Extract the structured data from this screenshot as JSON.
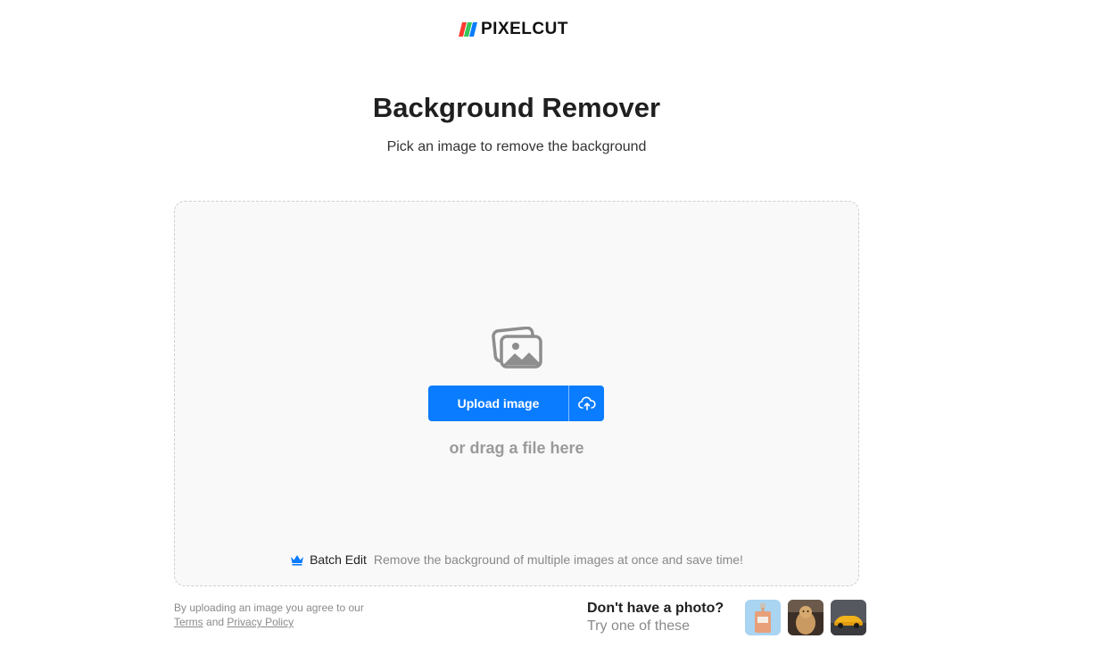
{
  "brand": {
    "name": "PIXELCUT",
    "stripe_colors": [
      "#ff3b30",
      "#34c759",
      "#0a7cff"
    ]
  },
  "header": {
    "title": "Background Remover",
    "subtitle": "Pick an image to remove the background"
  },
  "dropzone": {
    "icon": "photos-icon",
    "upload_label": "Upload image",
    "upload_menu_icon": "cloud-upload-icon",
    "drag_text": "or drag a file here",
    "batch": {
      "icon": "crown-icon",
      "label": "Batch Edit",
      "description": "Remove the background of multiple images at once and save time!"
    }
  },
  "legal": {
    "text": "By uploading an image you agree to our",
    "terms": "Terms",
    "and": "and",
    "privacy": "Privacy Policy"
  },
  "samples": {
    "question": "Don't have a photo?",
    "prompt": "Try one of these",
    "items": [
      {
        "name": "perfume",
        "bg": "#a9d4f2"
      },
      {
        "name": "dog",
        "bg": "#3c2f27"
      },
      {
        "name": "car",
        "bg": "#55585e"
      }
    ]
  },
  "colors": {
    "accent": "#0a7cff",
    "dropzone_bg": "#f9f9f9",
    "muted_text": "#9a9a9a"
  }
}
